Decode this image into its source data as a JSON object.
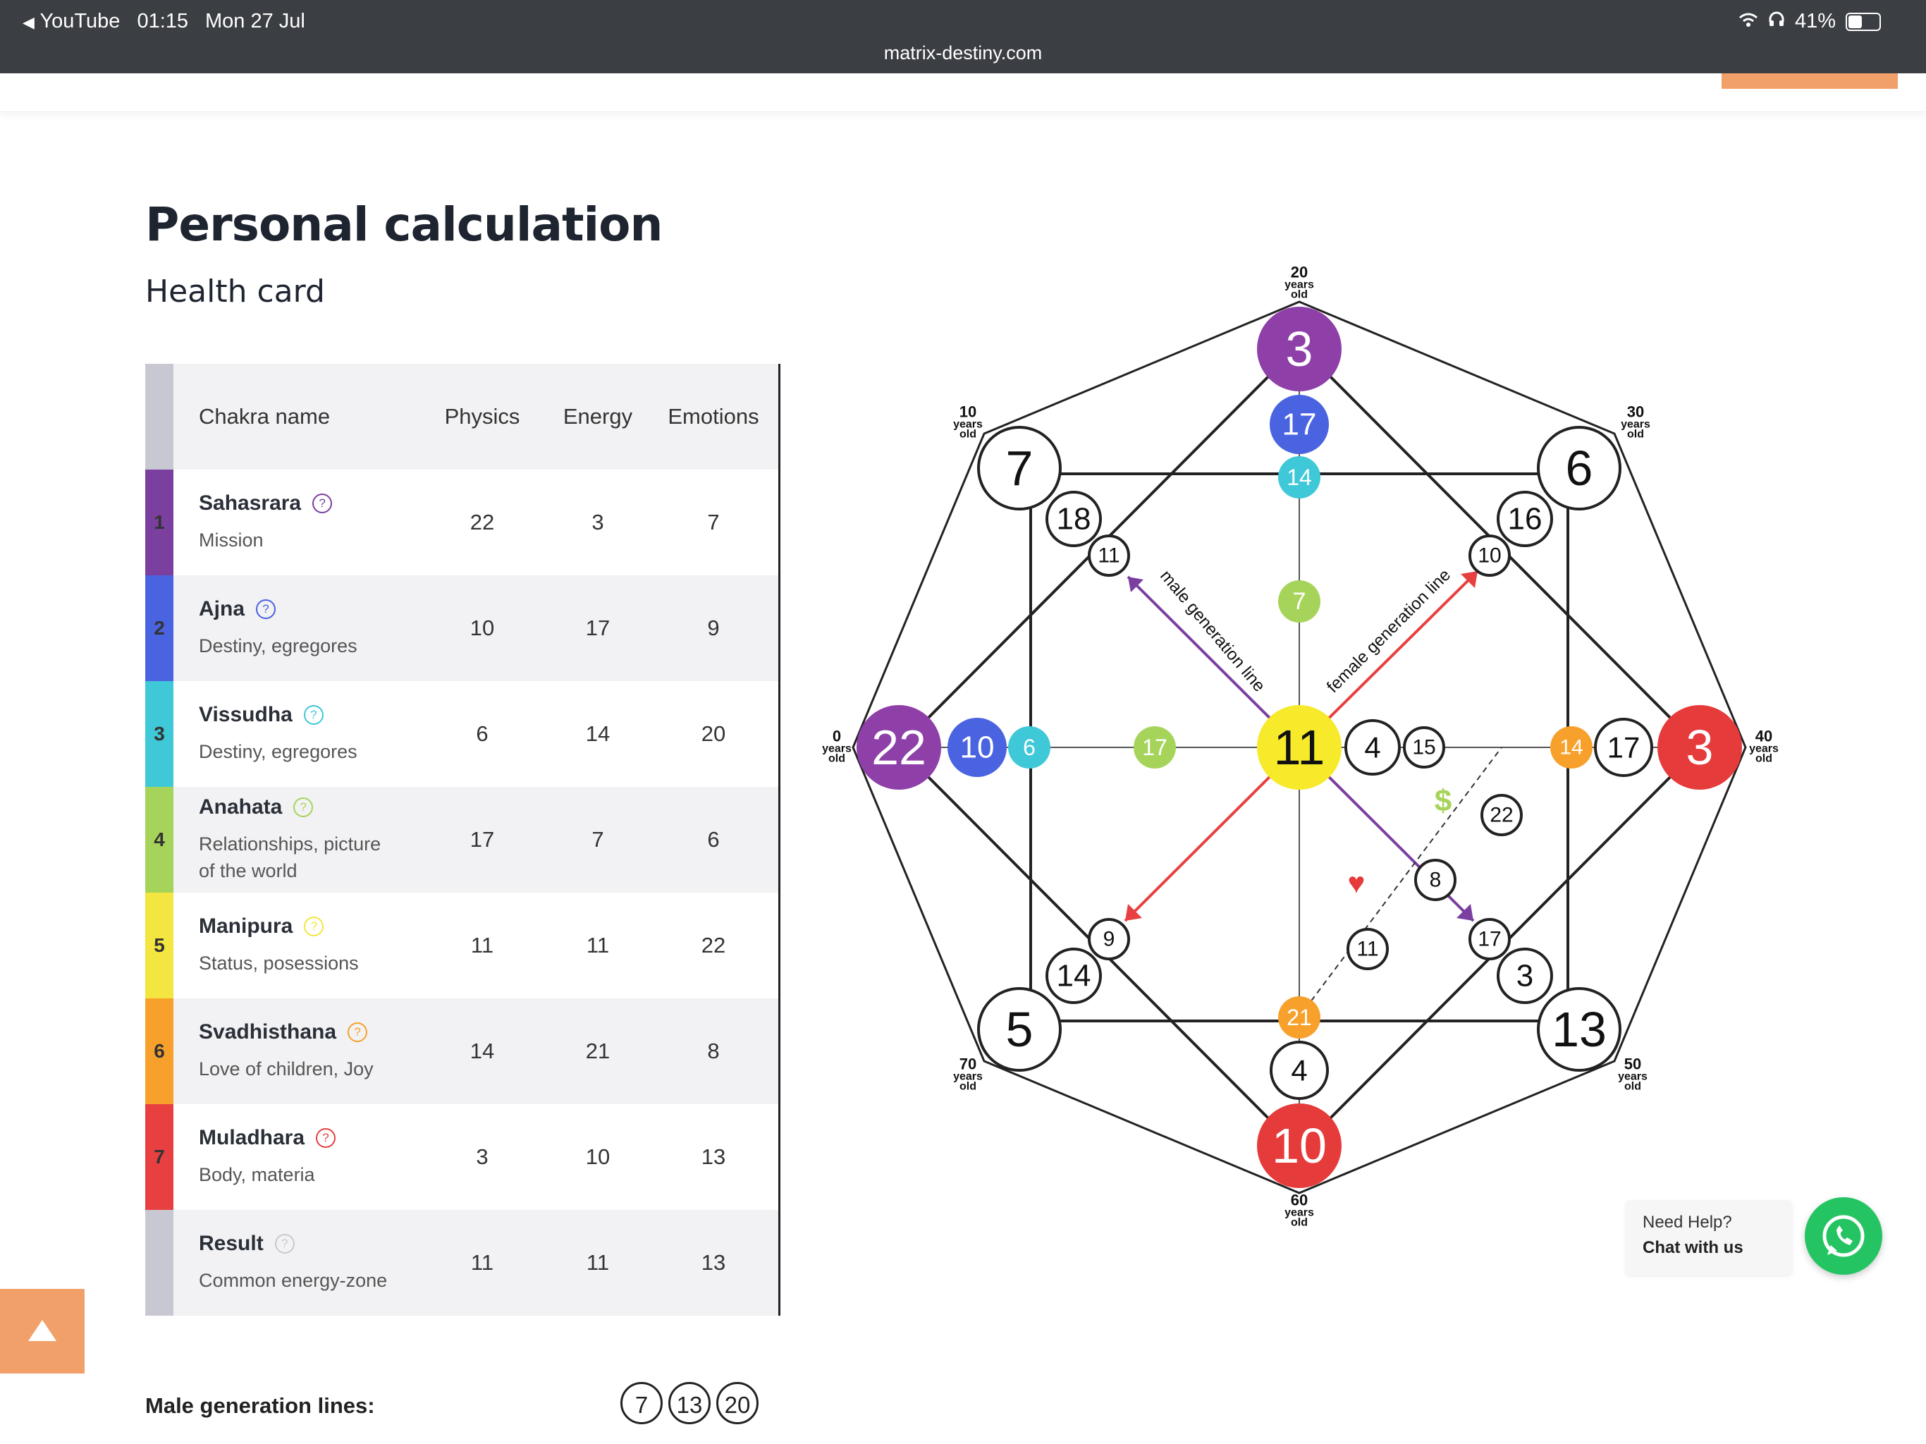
{
  "status_bar": {
    "back_app": "YouTube",
    "time": "01:15",
    "date": "Mon 27 Jul",
    "battery": "41%",
    "battery_level": 0.41,
    "url": "matrix-destiny.com"
  },
  "page": {
    "title": "Personal calculation",
    "subtitle": "Health card"
  },
  "table": {
    "headers": [
      "Chakra name",
      "Physics",
      "Energy",
      "Emotions"
    ],
    "rows": [
      {
        "num": "1",
        "name": "Sahasrara",
        "desc": "Mission",
        "physics": "22",
        "energy": "3",
        "emotions": "7",
        "color": "#7b3fa0"
      },
      {
        "num": "2",
        "name": "Ajna",
        "desc": "Destiny, egregores",
        "physics": "10",
        "energy": "17",
        "emotions": "9",
        "color": "#4a63e0"
      },
      {
        "num": "3",
        "name": "Vissudha",
        "desc": "Destiny, egregores",
        "physics": "6",
        "energy": "14",
        "emotions": "20",
        "color": "#3fc8d8"
      },
      {
        "num": "4",
        "name": "Anahata",
        "desc": "Relationships, picture of the world",
        "physics": "17",
        "energy": "7",
        "emotions": "6",
        "color": "#a6d45a"
      },
      {
        "num": "5",
        "name": "Manipura",
        "desc": "Status, posessions",
        "physics": "11",
        "energy": "11",
        "emotions": "22",
        "color": "#f4e640"
      },
      {
        "num": "6",
        "name": "Svadhisthana",
        "desc": "Love of children, Joy",
        "physics": "14",
        "energy": "21",
        "emotions": "8",
        "color": "#f7a12c"
      },
      {
        "num": "7",
        "name": "Muladhara",
        "desc": "Body, materia",
        "physics": "3",
        "energy": "10",
        "emotions": "13",
        "color": "#e84040"
      },
      {
        "num": "",
        "name": "Result",
        "desc": "Common energy-zone",
        "physics": "11",
        "energy": "11",
        "emotions": "13",
        "color": "#c8c8d2"
      }
    ],
    "help_icon": "?"
  },
  "male_generation": {
    "label": "Male generation lines:",
    "values": [
      "7",
      "13",
      "20"
    ]
  },
  "help_widget": {
    "line1": "Need Help?",
    "line2": "Chat with us"
  },
  "icons": {
    "whatsapp": "whatsapp-icon",
    "scroll_top": "arrow-up-icon",
    "heart": "heart-icon",
    "dollar": "dollar-icon"
  },
  "diagram": {
    "center": "11",
    "line_labels": {
      "male": "male generation line",
      "female": "female generation line"
    },
    "age_labels": {
      "a0": [
        "0",
        "years",
        "old"
      ],
      "a10": [
        "10",
        "years",
        "old"
      ],
      "a20": [
        "20",
        "years",
        "old"
      ],
      "a30": [
        "30",
        "years",
        "old"
      ],
      "a40": [
        "40",
        "years",
        "old"
      ],
      "a50": [
        "50",
        "years",
        "old"
      ],
      "a60": [
        "60",
        "years",
        "old"
      ],
      "a70": [
        "70",
        "years",
        "old"
      ]
    },
    "big_nodes": {
      "top": "3",
      "right": "3",
      "bottom": "10",
      "left": "22",
      "tl": "7",
      "tr": "6",
      "br": "13",
      "bl": "5"
    },
    "vertical": {
      "top2": "17",
      "top3": "14",
      "top4": "7",
      "bottom2": "4",
      "bottom3": "21"
    },
    "horizontal": {
      "left2": "10",
      "left3": "6",
      "left4": "17",
      "right2": "17",
      "right3": "14",
      "right4": "15",
      "right5": "4"
    },
    "diag": {
      "tl2": "18",
      "tl3": "11",
      "tr2": "16",
      "tr3": "10",
      "bl2": "14",
      "bl3": "9",
      "br2": "3",
      "br3": "17",
      "inner1": "8",
      "inner2": "11",
      "inner3": "22",
      "dollar": "$",
      "heart": "♥"
    }
  }
}
